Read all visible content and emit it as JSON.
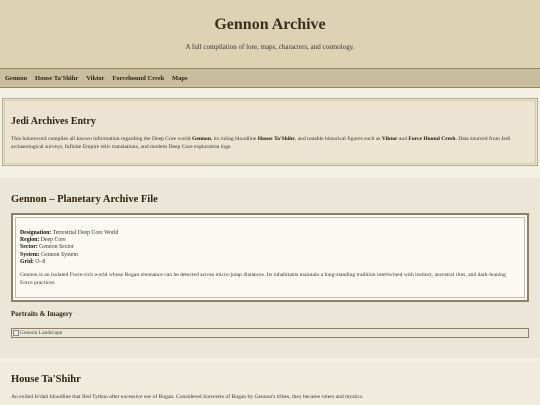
{
  "header": {
    "title": "Gennon Archive",
    "subtitle": "A full compilation of lore, maps, characters, and cosmology."
  },
  "nav": {
    "items": [
      "Gennon",
      "House Ta'Shihr",
      "Viktor",
      "Forcehound Cresh",
      "Maps"
    ]
  },
  "entry": {
    "title": "Jedi Archives Entry",
    "body_1": "This holorecord compiles all known information regarding the Deep Core world ",
    "bold_1": "Gennon",
    "body_2": ", its ruling bloodline ",
    "bold_2": "House Ta'Shihr",
    "body_3": ", and notable historical figures such as ",
    "bold_3": "Viktor",
    "body_4": " and ",
    "bold_4": "Force Hound Cresh",
    "body_5": ". Data sourced from Jedi archaeological surveys, Infinite Empire relic translations, and modern Deep Core exploration logs."
  },
  "gennon": {
    "title": "Gennon – Planetary Archive File",
    "fields": [
      {
        "label": "Designation:",
        "value": " Terrestrial Deep Core World"
      },
      {
        "label": "Region:",
        "value": " Deep Core"
      },
      {
        "label": "Sector:",
        "value": " Gennon Sector"
      },
      {
        "label": "System:",
        "value": " Gennon System"
      },
      {
        "label": "Grid:",
        "value": " O–8"
      }
    ],
    "description": "Gennon is an isolated Force-rich world whose Bogan resonance can be detected across micro-jump distances. Its inhabitants maintain a long-standing tradition intertwined with instinct, ancestral rites, and dark-leaning Force practices.",
    "portraits_title": "Portraits & Imagery",
    "image_alt": "Gennon Landscape"
  },
  "house": {
    "title": "House Ta'Shihr",
    "body": "An exiled Je'daii bloodline that fled Tython after excessive use of Bogan. Considered Sorcerers of Bogan by Gennon's tribes, they became rulers and mystics."
  }
}
